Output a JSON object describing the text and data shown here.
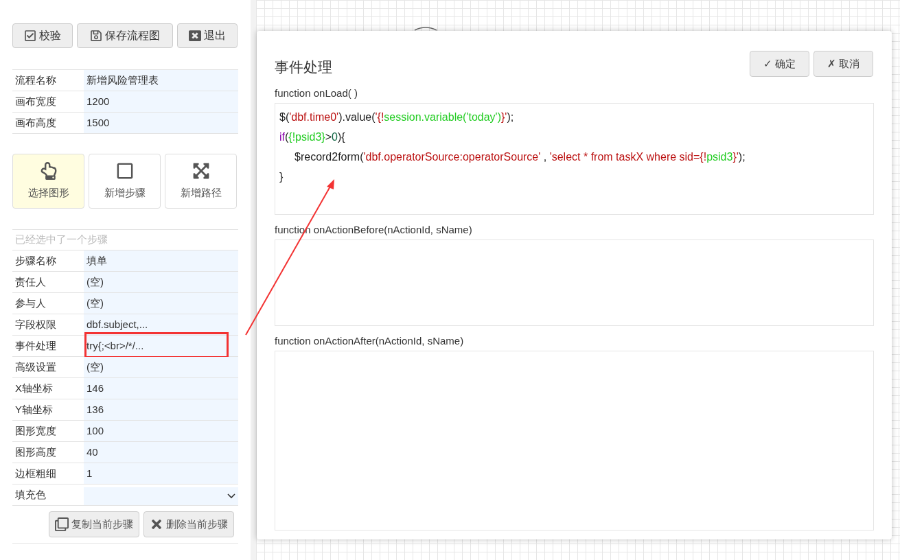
{
  "toolbar": [
    {
      "label": "校验"
    },
    {
      "label": "保存流程图"
    },
    {
      "label": "退出"
    }
  ],
  "flow_props": [
    {
      "label": "流程名称",
      "value": "新增风险管理表"
    },
    {
      "label": "画布宽度",
      "value": "1200"
    },
    {
      "label": "画布高度",
      "value": "1500"
    }
  ],
  "tools": [
    {
      "label": "选择图形",
      "selected": true
    },
    {
      "label": "新增步骤",
      "selected": false
    },
    {
      "label": "新增路径",
      "selected": false
    }
  ],
  "selection_title": "已经选中了一个步骤",
  "step_props": [
    {
      "label": "步骤名称",
      "value": "填单",
      "kind": "text",
      "highlighted": false
    },
    {
      "label": "责任人",
      "value": "(空)",
      "kind": "text",
      "highlighted": false
    },
    {
      "label": "参与人",
      "value": "(空)",
      "kind": "text",
      "highlighted": false
    },
    {
      "label": "字段权限",
      "value": "dbf.subject,...",
      "kind": "text",
      "highlighted": false
    },
    {
      "label": "事件处理",
      "value": "try{;<br>/*/...",
      "kind": "text",
      "highlighted": true
    },
    {
      "label": "高级设置",
      "value": "(空)",
      "kind": "text",
      "highlighted": false
    },
    {
      "label": "X轴坐标",
      "value": "146",
      "kind": "text",
      "highlighted": false
    },
    {
      "label": "Y轴坐标",
      "value": "136",
      "kind": "text",
      "highlighted": false
    },
    {
      "label": "图形宽度",
      "value": "100",
      "kind": "text",
      "highlighted": false
    },
    {
      "label": "图形高度",
      "value": "40",
      "kind": "text",
      "highlighted": false
    },
    {
      "label": "边框粗细",
      "value": "1",
      "kind": "text",
      "highlighted": false
    },
    {
      "label": "填充色",
      "kind": "select",
      "highlighted": false
    }
  ],
  "step_actions": [
    {
      "label": "复制当前步骤"
    },
    {
      "label": "删除当前步骤"
    }
  ],
  "dialog": {
    "title": "事件处理",
    "buttons": [
      {
        "label": "✓ 确定"
      },
      {
        "label": "✗ 取消"
      }
    ],
    "editors": [
      {
        "label": "function onLoad( )",
        "lines": [
          {
            "indented": false,
            "tokens": [
              {
                "kind": "plain",
                "text": "$("
              },
              {
                "kind": "string",
                "text": "'dbf.time0'"
              },
              {
                "kind": "plain",
                "text": ").value("
              },
              {
                "kind": "string",
                "text": "'{!"
              },
              {
                "kind": "var",
                "text": "session.variable('today')"
              },
              {
                "kind": "string",
                "text": "}'"
              },
              {
                "kind": "plain",
                "text": ");"
              }
            ]
          },
          {
            "indented": false,
            "tokens": [
              {
                "kind": "keyword",
                "text": "if"
              },
              {
                "kind": "plain",
                "text": "("
              },
              {
                "kind": "var",
                "text": "{!psid3}"
              },
              {
                "kind": "plain",
                "text": ">"
              },
              {
                "kind": "number",
                "text": "0"
              },
              {
                "kind": "plain",
                "text": "){"
              }
            ]
          },
          {
            "indented": true,
            "tokens": [
              {
                "kind": "plain",
                "text": "$record2form("
              },
              {
                "kind": "string",
                "text": "'dbf.operatorSource:operatorSource'"
              },
              {
                "kind": "plain",
                "text": " , "
              },
              {
                "kind": "string",
                "text": "'select * from taskX where sid={!"
              },
              {
                "kind": "var",
                "text": "psid3"
              },
              {
                "kind": "string",
                "text": "}'"
              },
              {
                "kind": "plain",
                "text": ");"
              }
            ]
          },
          {
            "indented": false,
            "tokens": [
              {
                "kind": "plain",
                "text": "}"
              }
            ]
          }
        ]
      },
      {
        "label": "function onActionBefore(nActionId, sName)"
      },
      {
        "label": "function onActionAfter(nActionId, sName)"
      }
    ]
  }
}
